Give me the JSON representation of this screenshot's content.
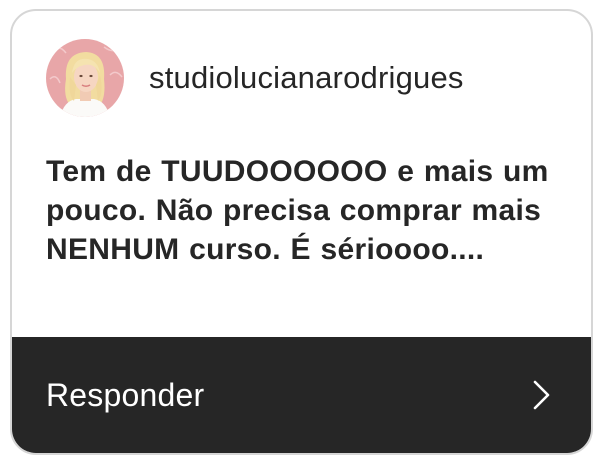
{
  "comment": {
    "username": "studiolucianarodrigues",
    "text": "Tem de TUUDOOOOOO e mais um pouco. Não precisa comprar mais NENHUM curso. É sérioooo...."
  },
  "reply": {
    "label": "Responder",
    "icon": "chevron-right-icon"
  },
  "colors": {
    "reply_bar": "#262626",
    "avatar_bg": "#e8a6a8",
    "text": "#262626"
  }
}
